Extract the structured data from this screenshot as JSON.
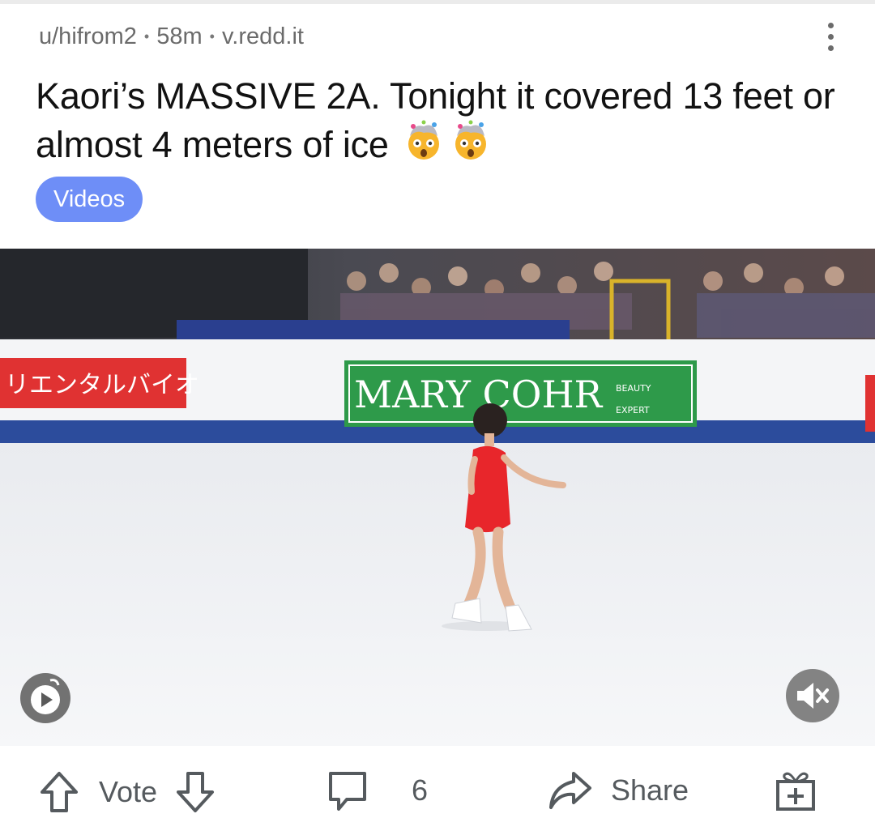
{
  "post": {
    "author": "u/hifrom2",
    "age": "58m",
    "domain": "v.redd.it",
    "title": "Kaori’s MASSIVE 2A. Tonight it covered 13 feet or almost 4 meters of ice",
    "flair": "Videos"
  },
  "video": {
    "sponsor_left": "リエンタルバイオ",
    "sponsor_main": "MARY COHR",
    "sponsor_tag_1": "BEAUTY",
    "sponsor_tag_2": "EXPERT"
  },
  "actions": {
    "vote_label": "Vote",
    "comments_count": "6",
    "share_label": "Share"
  },
  "colors": {
    "flair_bg": "#6e8ef7",
    "icon_gray": "#555a5e",
    "dress_red": "#e8262b",
    "sponsor_green": "#2e9a4a"
  },
  "icons": [
    "overflow-menu-icon",
    "exploding-head-emoji",
    "reddit-video-icon",
    "mute-icon",
    "upvote-icon",
    "downvote-icon",
    "comment-icon",
    "share-icon",
    "award-icon"
  ]
}
